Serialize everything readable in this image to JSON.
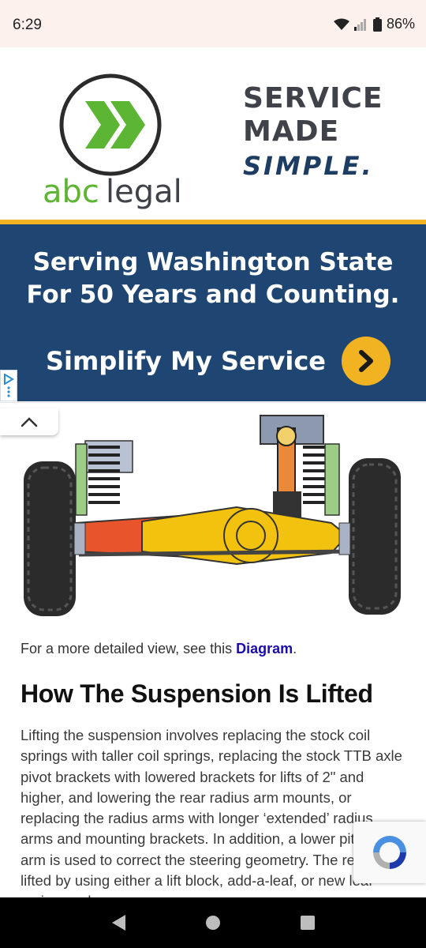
{
  "status_bar": {
    "time": "6:29",
    "battery": "86%",
    "icons": [
      "wifi-icon",
      "signal-icon",
      "battery-icon"
    ]
  },
  "ad": {
    "brand_name": "abclegal",
    "slogan_line1": "SERVICE",
    "slogan_line2": "MADE",
    "slogan_line3": "SIMPLE.",
    "headline_line1": "Serving Washington State",
    "headline_line2": "For 50 Years and Counting.",
    "cta_label": "Simplify My Service",
    "colors": {
      "blue": "#1f4673",
      "gold": "#f2b322",
      "green": "#5cb533",
      "dark": "#3f4349"
    }
  },
  "article": {
    "caption_prefix": "For a more detailed view, see this ",
    "caption_link": "Diagram",
    "caption_suffix": ".",
    "heading": "How The Suspension Is Lifted",
    "body": "Lifting the suspension involves replacing the stock coil springs with taller coil springs, replacing the stock TTB axle pivot brackets with lowered brackets for lifts of 2\" and higher, and lowering the rear radius arm mounts, or replacing the radius arms with longer ‘extended’ radius arms and mounting brackets. In addition, a lower pitman arm is used to correct the steering geometry. The rear is lifted by using either a lift block, add-a-leaf, or new leaf spring packs."
  },
  "nav": {
    "icons": [
      "back-icon",
      "home-icon",
      "recents-icon"
    ]
  }
}
